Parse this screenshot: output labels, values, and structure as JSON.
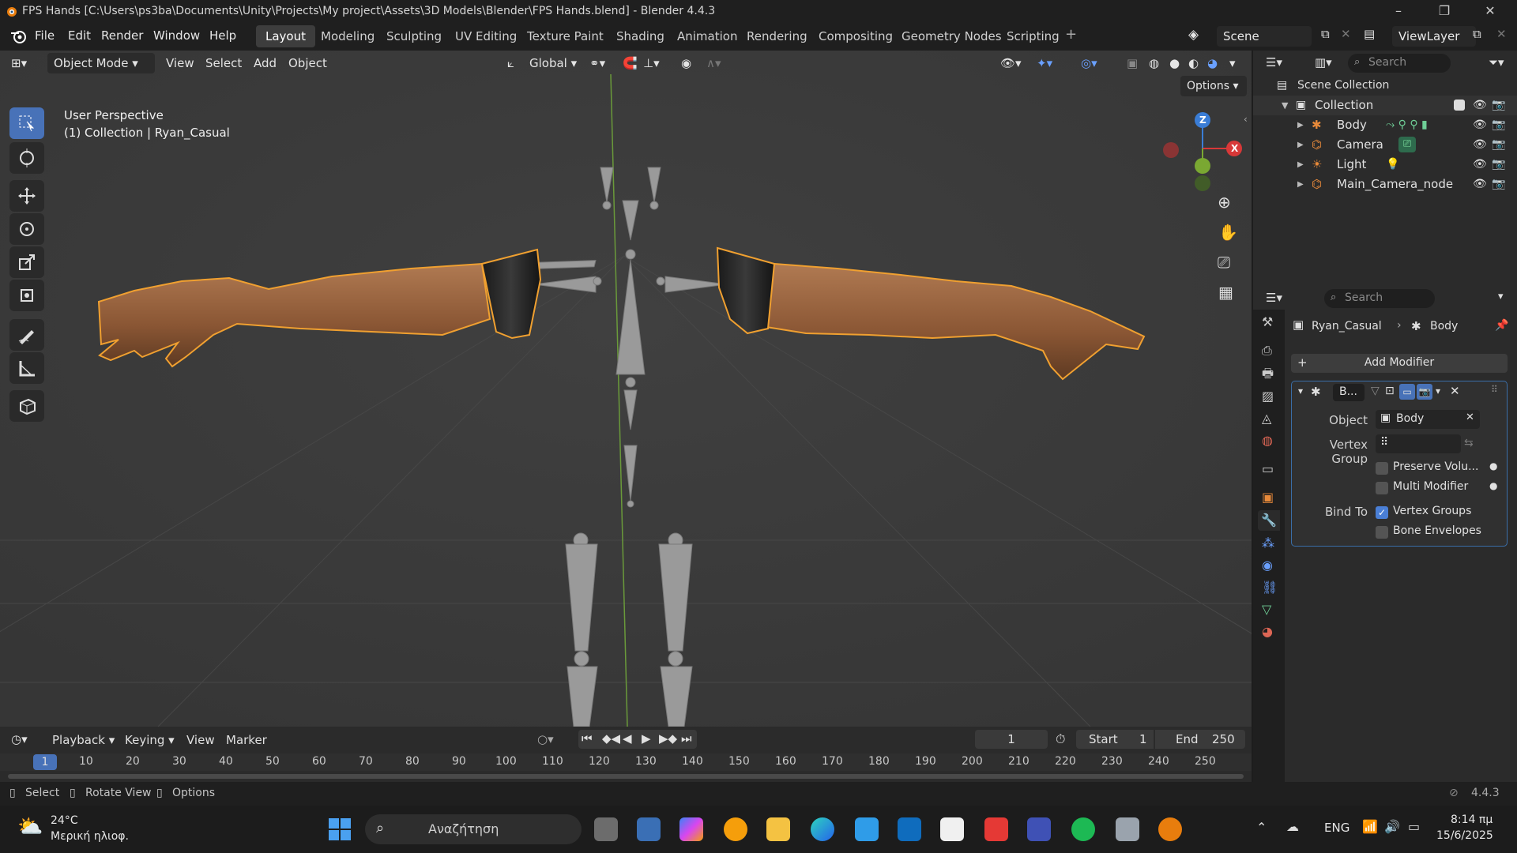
{
  "window": {
    "title": "FPS Hands [C:\\Users\\ps3ba\\Documents\\Unity\\Projects\\My project\\Assets\\3D Models\\Blender\\FPS Hands.blend] - Blender 4.4.3"
  },
  "menu": [
    "File",
    "Edit",
    "Render",
    "Window",
    "Help"
  ],
  "workspaces": [
    "Layout",
    "Modeling",
    "Sculpting",
    "UV Editing",
    "Texture Paint",
    "Shading",
    "Animation",
    "Rendering",
    "Compositing",
    "Geometry Nodes",
    "Scripting"
  ],
  "scene_name": "Scene",
  "view_layer": "ViewLayer",
  "viewport": {
    "mode": "Object Mode",
    "menus": [
      "View",
      "Select",
      "Add",
      "Object"
    ],
    "transform_orientation": "Global",
    "options_label": "Options",
    "info_line1": "User Perspective",
    "info_line2": "(1) Collection | Ryan_Casual",
    "gizmo": {
      "x": "X",
      "z": "Z"
    }
  },
  "outliner": {
    "search_placeholder": "Search",
    "root": "Scene Collection",
    "collection": "Collection",
    "items": [
      {
        "name": "Body"
      },
      {
        "name": "Camera"
      },
      {
        "name": "Light"
      },
      {
        "name": "Main_Camera_node"
      }
    ]
  },
  "properties": {
    "search_placeholder": "Search",
    "breadcrumb_object": "Ryan_Casual",
    "breadcrumb_modifier": "Body",
    "add_modifier": "Add Modifier",
    "modifier_name": "B...",
    "object_label": "Object",
    "object_value": "Body",
    "vertex_group_label": "Vertex Group",
    "preserve_volume": "Preserve Volu...",
    "multi_modifier": "Multi Modifier",
    "bind_to_label": "Bind To",
    "vertex_groups": "Vertex Groups",
    "bone_envelopes": "Bone Envelopes"
  },
  "timeline": {
    "menus": [
      "Playback",
      "Keying",
      "View",
      "Marker"
    ],
    "current_frame": "1",
    "start_label": "Start",
    "start": "1",
    "end_label": "End",
    "end": "250",
    "ruler": [
      "1",
      "10",
      "20",
      "30",
      "40",
      "50",
      "60",
      "70",
      "80",
      "90",
      "100",
      "110",
      "120",
      "130",
      "140",
      "150",
      "160",
      "170",
      "180",
      "190",
      "200",
      "210",
      "220",
      "230",
      "240",
      "250"
    ]
  },
  "status": {
    "select": "Select",
    "rotate": "Rotate View",
    "options": "Options",
    "version": "4.4.3"
  },
  "taskbar": {
    "weather_temp": "24°C",
    "weather_desc": "Μερική ηλιοφ.",
    "search": "Αναζήτηση",
    "lang": "ENG",
    "time": "8:14 πμ",
    "date": "15/6/2025"
  },
  "colors": {
    "accent": "#4872b8",
    "selection_outline": "#f0a030",
    "viewport_bg": "#3c3c3c"
  }
}
